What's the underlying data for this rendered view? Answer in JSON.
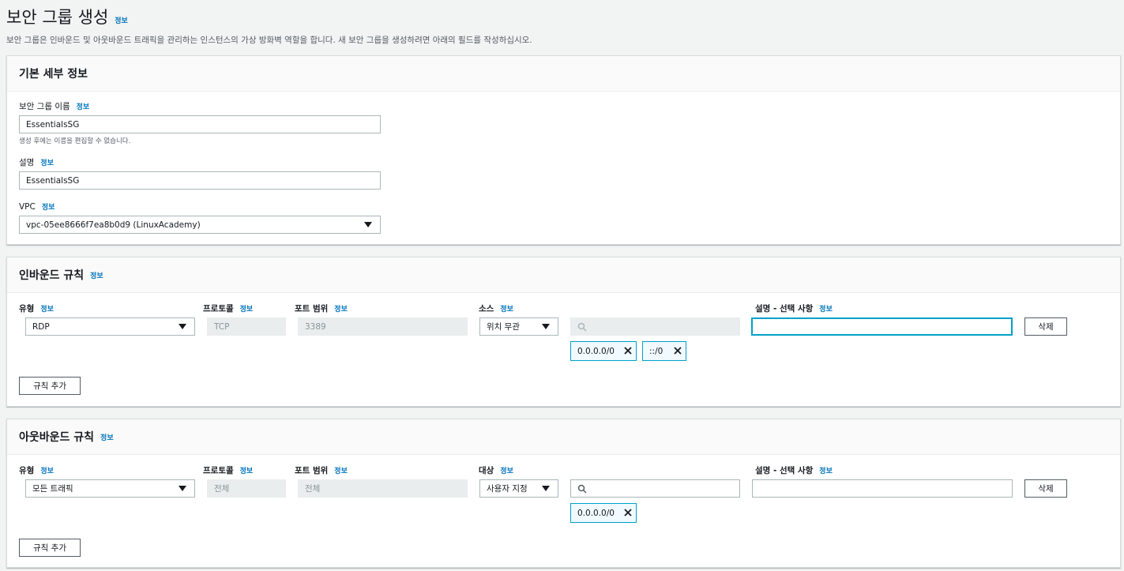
{
  "page": {
    "title": "보안 그룹 생성",
    "info": "정보",
    "description": "보안 그룹은 인바운드 및 아웃바운드 트래픽을 관리하는 인스턴스의 가상 방화벽 역할을 합니다. 새 보안 그룹을 생성하려면 아래의 필드를 작성하십시오."
  },
  "basic": {
    "title": "기본 세부 정보",
    "name_label": "보안 그룹 이름",
    "name_value": "EssentialsSG",
    "name_hint": "생성 후에는 이름을 편집할 수 없습니다.",
    "desc_label": "설명",
    "desc_value": "EssentialsSG",
    "vpc_label": "VPC",
    "vpc_value": "vpc-05ee8666f7ea8b0d9 (LinuxAcademy)"
  },
  "inbound": {
    "title": "인바운드 규칙",
    "col_type": "유형",
    "col_protocol": "프로토콜",
    "col_port": "포트 범위",
    "col_source": "소스",
    "col_desc": "설명 - 선택 사항",
    "row": {
      "type": "RDP",
      "protocol": "TCP",
      "port": "3389",
      "source": "위치 무관",
      "tokens": [
        "0.0.0.0/0",
        "::/0"
      ],
      "desc": ""
    },
    "delete": "삭제",
    "add": "규칙 추가"
  },
  "outbound": {
    "title": "아웃바운드 규칙",
    "col_type": "유형",
    "col_protocol": "프로토콜",
    "col_port": "포트 범위",
    "col_dest": "대상",
    "col_desc": "설명 - 선택 사항",
    "row": {
      "type": "모든 트래픽",
      "protocol": "전체",
      "port": "전체",
      "dest": "사용자 지정",
      "tokens": [
        "0.0.0.0/0"
      ],
      "desc": ""
    },
    "delete": "삭제",
    "add": "규칙 추가"
  },
  "icons": {
    "search": "search-icon",
    "close": "close-icon",
    "dropdown": "caret-down-icon"
  },
  "colors": {
    "link": "#0073bb",
    "focus": "#00a1c9",
    "background": "#f2f3f3"
  }
}
